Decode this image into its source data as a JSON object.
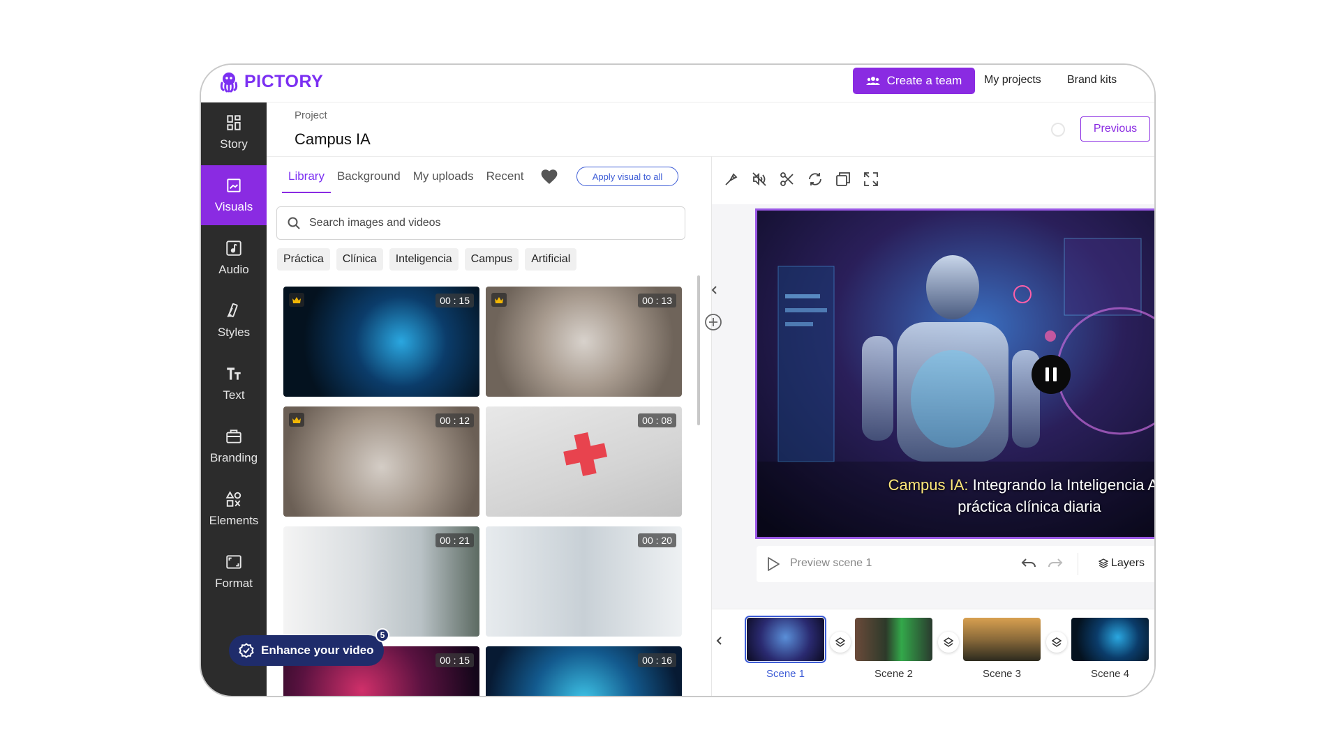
{
  "app": {
    "logo_text": "PICTORY"
  },
  "topbar": {
    "create_team": "Create a team",
    "my_projects": "My projects",
    "brand_kits": "Brand kits"
  },
  "sidebar": {
    "items": [
      {
        "label": "Story",
        "icon": "grid-icon"
      },
      {
        "label": "Visuals",
        "icon": "image-icon",
        "active": true
      },
      {
        "label": "Audio",
        "icon": "music-note-icon"
      },
      {
        "label": "Styles",
        "icon": "palette-icon"
      },
      {
        "label": "Text",
        "icon": "text-icon"
      },
      {
        "label": "Branding",
        "icon": "briefcase-icon"
      },
      {
        "label": "Elements",
        "icon": "shapes-icon"
      },
      {
        "label": "Format",
        "icon": "aspect-ratio-icon"
      }
    ]
  },
  "project": {
    "label": "Project",
    "title": "Campus IA",
    "previous": "Previous"
  },
  "library": {
    "tabs": [
      "Library",
      "Background",
      "My uploads",
      "Recent"
    ],
    "apply_all": "Apply visual to all",
    "search_placeholder": "Search images and videos",
    "chips": [
      "Práctica",
      "Clínica",
      "Inteligencia",
      "Campus",
      "Artificial"
    ],
    "items": [
      {
        "duration": "00 : 15",
        "premium": true
      },
      {
        "duration": "00 : 13",
        "premium": true
      },
      {
        "duration": "00 : 12",
        "premium": true
      },
      {
        "duration": "00 : 08",
        "premium": false
      },
      {
        "duration": "00 : 21",
        "premium": false
      },
      {
        "duration": "00 : 20",
        "premium": false
      },
      {
        "duration": "00 : 15",
        "premium": false
      },
      {
        "duration": "00 : 16",
        "premium": false
      }
    ]
  },
  "enhance": {
    "label": "Enhance your video",
    "badge": "5"
  },
  "preview": {
    "caption_highlight": "Campus IA:",
    "caption_rest": " Integrando la Inteligencia Arti",
    "caption_line2": "práctica clínica diaria",
    "preview_label": "Preview scene 1",
    "layers": "Layers"
  },
  "timeline": {
    "scenes": [
      {
        "label": "Scene 1",
        "active": true
      },
      {
        "label": "Scene 2"
      },
      {
        "label": "Scene 3"
      },
      {
        "label": "Scene 4"
      }
    ]
  },
  "colors": {
    "accent": "#8a2be2",
    "sidebar": "#2c2c2c",
    "link_blue": "#3d5cd6"
  }
}
